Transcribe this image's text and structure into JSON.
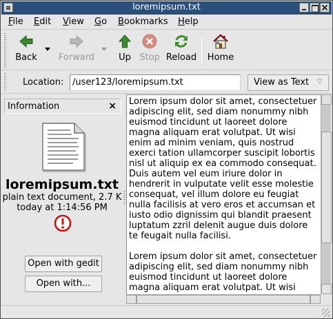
{
  "window": {
    "title": "loremipsum.txt"
  },
  "menu": {
    "items": [
      {
        "underline": "F",
        "rest": "ile"
      },
      {
        "underline": "E",
        "rest": "dit"
      },
      {
        "underline": "V",
        "rest": "iew"
      },
      {
        "underline": "G",
        "rest": "o"
      },
      {
        "underline": "B",
        "rest": "ookmarks"
      },
      {
        "underline": "H",
        "rest": "elp"
      }
    ]
  },
  "toolbar": {
    "back": "Back",
    "forward": "Forward",
    "up": "Up",
    "stop": "Stop",
    "reload": "Reload",
    "home": "Home"
  },
  "location": {
    "label": "Location:",
    "value": "/user123/loremipsum.txt",
    "view_as": "View as Text"
  },
  "sidebar": {
    "title": "Information",
    "close": "×",
    "file_name": "loremipsum.txt",
    "file_type": "plain text document, 2.7 K",
    "modified": "today at 1:14:56 PM",
    "open_with_default": "Open with gedit",
    "open_with": "Open with..."
  },
  "document": {
    "text": "Lorem ipsum dolor sit amet, consectetuer\nadipiscing elit, sed diam nonummy nibh\neuismod tincidunt ut laoreet dolore\nmagna aliquam erat volutpat. Ut wisi\nenim ad minim veniam, quis nostrud\nexerci tation ullamcorper suscipit lobortis\nnisl ut aliquip ex ea commodo consequat.\nDuis autem vel eum iriure dolor in\nhendrerit in vulputate velit esse molestie\nconsequat, vel illum dolore eu feugiat\nnulla facilisis at vero eros et accumsan et\niusto odio dignissim qui blandit praesent\nluptatum zzril delenit augue duis dolore\nte feugait nulla facilisi.\n\nLorem ipsum dolor sit amet, consectetuer\nadipiscing elit, sed diam nonummy nibh\neuismod tincidunt ut laoreet dolore\nmagna aliquam erat volutpat. Ut wisi"
  },
  "icons": {
    "back": "back-arrow-icon",
    "forward": "forward-arrow-icon",
    "up": "up-arrow-icon",
    "stop": "stop-icon",
    "reload": "reload-icon",
    "home": "home-icon",
    "document": "text-document-icon",
    "warning": "warning-icon"
  },
  "colors": {
    "titlebar": "#2b4f7c",
    "arrow_green": "#3c8a2e",
    "stop_red": "#c8402e",
    "warning_red": "#d01010"
  }
}
